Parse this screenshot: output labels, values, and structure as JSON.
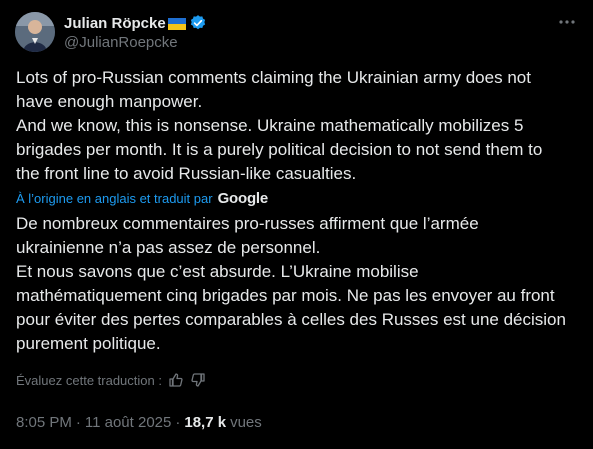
{
  "author": {
    "name": "Julian Röpcke",
    "handle": "@JulianRoepcke"
  },
  "tweet": {
    "text": "Lots of pro-Russian comments claiming the Ukrainian army does not\nhave enough manpower.\nAnd we know, this is nonsense. Ukraine mathematically mobilizes 5\nbrigades per month. It is a purely political decision to not send them to\nthe front line to avoid Russian-like casualties."
  },
  "translation": {
    "label": "À l’origine en anglais et traduit par",
    "provider": "Google",
    "text": "De nombreux commentaires pro-russes affirment que l’armée\nukrainienne n’a pas assez de personnel.\nEt nous savons que c’est absurde. L’Ukraine mobilise\nmathématiquement cinq brigades par mois. Ne pas les envoyer au front\npour éviter des pertes comparables à celles des Russes est une décision\npurement politique.",
    "rate_label": "Évaluez cette traduction :"
  },
  "meta": {
    "time": "8:05 PM",
    "separator": "·",
    "date": "11 août 2025",
    "views_count": "18,7 k",
    "views_label": "vues"
  },
  "colors": {
    "background": "#000000",
    "text": "#e7e9ea",
    "muted": "#71767b",
    "accent": "#1d9bf0"
  },
  "icons": {
    "verified": "verified-badge-icon",
    "flag": "ukraine-flag-icon",
    "more": "more-dots-icon",
    "thumbs_up": "thumbs-up-icon",
    "thumbs_down": "thumbs-down-icon"
  }
}
